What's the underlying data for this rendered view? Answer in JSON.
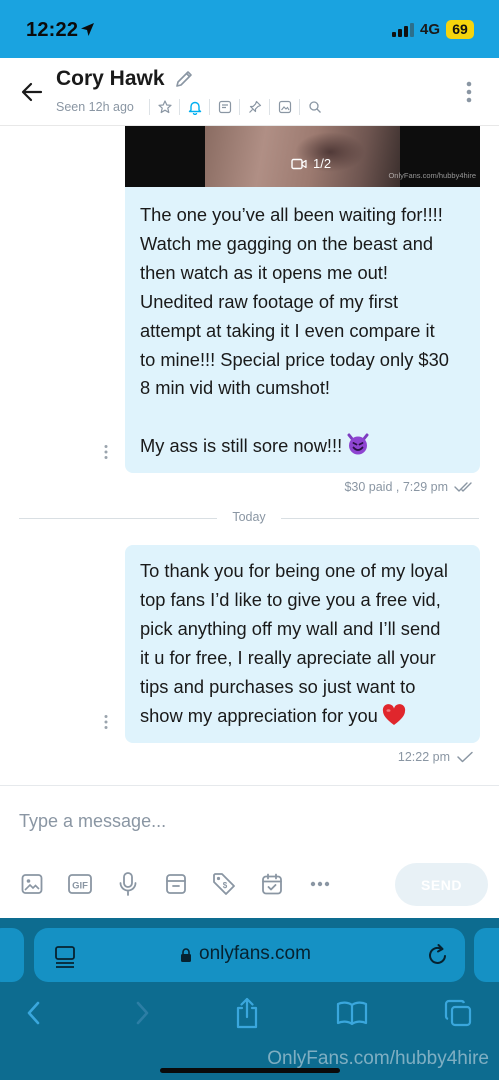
{
  "status_bar": {
    "time": "12:22",
    "network": "4G",
    "battery": "69"
  },
  "header": {
    "contact_name": "Cory Hawk",
    "seen": "Seen 12h ago",
    "tool_icons": [
      "star-icon",
      "bell-icon",
      "note-icon",
      "pin-icon",
      "gallery-icon",
      "search-icon"
    ]
  },
  "messages": [
    {
      "video_counter": "1/2",
      "video_watermark": "OnlyFans.com/hubby4hire",
      "lines": [
        "The one you’ve all been waiting for!!!!",
        "Watch me gagging on the beast and",
        "then watch as it opens me out!",
        "Unedited raw footage of my first",
        "attempt at taking it I even compare it",
        "to mine!!! Special price today only $30",
        "8 min vid with cumshot!"
      ],
      "last_line": "My ass is still sore now!!!",
      "meta": "$30 paid ,  7:29 pm"
    },
    {
      "lines": [
        "To thank you for being one of my loyal",
        "top fans I’d like to give you a free vid,",
        "pick anything off my wall and I’ll send",
        "it u for free, I really apreciate all your",
        "tips and purchases so just want to"
      ],
      "last_line": "show my appreciation for you",
      "meta": "12:22 pm"
    }
  ],
  "day_divider": "Today",
  "composer": {
    "placeholder": "Type a message...",
    "send_label": "SEND",
    "tool_icons": [
      "image-icon",
      "gif-icon",
      "microphone-icon",
      "vault-icon",
      "price-tag-icon",
      "schedule-icon",
      "more-icon"
    ]
  },
  "browser": {
    "url": "onlyfans.com",
    "toolbar_icons": [
      "back-icon",
      "forward-icon",
      "share-icon",
      "bookmarks-icon",
      "tabs-icon"
    ]
  },
  "watermark": "OnlyFans.com/hubby4hire",
  "colors": {
    "status_bar": "#1aa3e0",
    "bubble": "#dff3fc",
    "browser_bar": "#0d6c90",
    "url_pill": "#1591c4",
    "accent": "#00aff0",
    "muted_text": "#8a96a3"
  }
}
